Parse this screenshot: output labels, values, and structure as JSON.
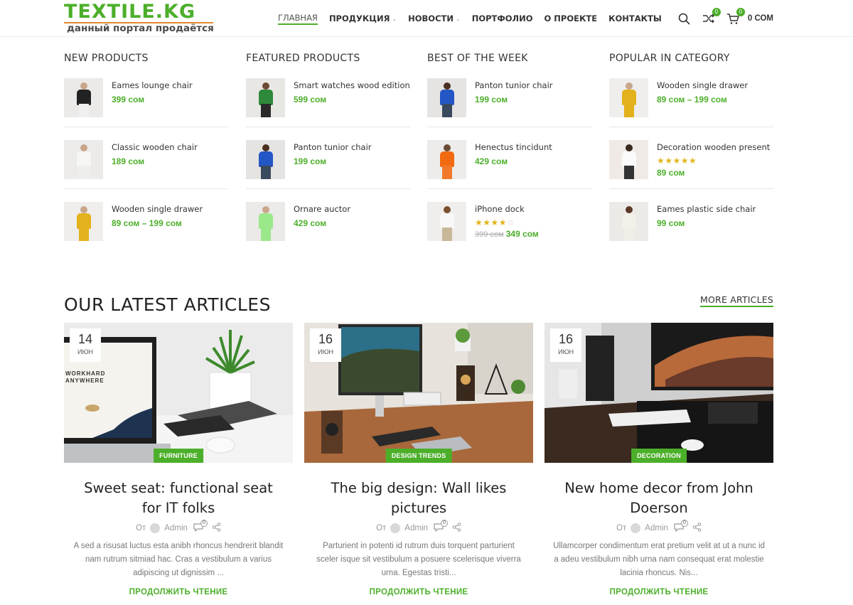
{
  "header": {
    "logo_main": "TEXTILE.KG",
    "logo_sub": "данный портал продаётся",
    "nav": [
      {
        "label": "ГЛАВНАЯ",
        "active": true,
        "dropdown": false
      },
      {
        "label": "ПРОДУКЦИЯ",
        "active": false,
        "dropdown": true
      },
      {
        "label": "НОВОСТИ",
        "active": false,
        "dropdown": true
      },
      {
        "label": "ПОРТФОЛИО",
        "active": false,
        "dropdown": false
      },
      {
        "label": "О ПРОЕКТЕ",
        "active": false,
        "dropdown": false
      },
      {
        "label": "КОНТАКТЫ",
        "active": false,
        "dropdown": false
      }
    ],
    "icons": {
      "search": "search-icon",
      "compare": "compare-icon",
      "cart": "cart-icon"
    },
    "compare_count": "0",
    "cart_count": "0",
    "cart_total": "0 СОМ"
  },
  "columns": [
    {
      "title": "NEW PRODUCTS",
      "items": [
        {
          "name": "Eames lounge chair",
          "price": "399 сом",
          "old_price": "",
          "stars": 0
        },
        {
          "name": "Classic wooden chair",
          "price": "189 сом",
          "old_price": "",
          "stars": 0
        },
        {
          "name": "Wooden single drawer",
          "price": "89 сом – 199 сом",
          "old_price": "",
          "stars": 0
        }
      ]
    },
    {
      "title": "FEATURED PRODUCTS",
      "items": [
        {
          "name": "Smart watches wood edition",
          "price": "599 сом",
          "old_price": "",
          "stars": 0
        },
        {
          "name": "Panton tunior chair",
          "price": "199 сом",
          "old_price": "",
          "stars": 0
        },
        {
          "name": "Ornare auctor",
          "price": "429 сом",
          "old_price": "",
          "stars": 0
        }
      ]
    },
    {
      "title": "BEST OF THE WEEK",
      "items": [
        {
          "name": "Panton tunior chair",
          "price": "199 сом",
          "old_price": "",
          "stars": 0
        },
        {
          "name": "Henectus tincidunt",
          "price": "429 сом",
          "old_price": "",
          "stars": 0
        },
        {
          "name": "iPhone dock",
          "price": "349 сом",
          "old_price": "399 сом",
          "stars": 4
        }
      ]
    },
    {
      "title": "POPULAR IN CATEGORY",
      "items": [
        {
          "name": "Wooden single drawer",
          "price": "89 сом – 199 сом",
          "old_price": "",
          "stars": 0
        },
        {
          "name": "Decoration wooden present",
          "price": "89 сом",
          "old_price": "",
          "stars": 5
        },
        {
          "name": "Eames plastic side chair",
          "price": "99 сом",
          "old_price": "",
          "stars": 0
        }
      ]
    }
  ],
  "articles_section": {
    "title": "OUR LATEST ARTICLES",
    "more_label": "MORE ARTICLES"
  },
  "articles": [
    {
      "day": "14",
      "month": "ИЮН",
      "category": "FURNITURE",
      "title": "Sweet seat: functional seat for IT folks",
      "by": "От",
      "author": "Admin",
      "comments": "0",
      "excerpt": "A sed a risusat luctus esta anibh rhoncus hendrerit blandit nam rutrum sitmiad hac. Cras a vestibulum a varius adipiscing ut dignissim ...",
      "read_more": "ПРОДОЛЖИТЬ ЧТЕНИЕ",
      "laptop_text": "WORKHARD ANYWHERE"
    },
    {
      "day": "16",
      "month": "ИЮН",
      "category": "DESIGN TRENDS",
      "title": "The big design: Wall likes pictures",
      "by": "От",
      "author": "Admin",
      "comments": "0",
      "excerpt": "Parturient in potenti id rutrum duis torquent parturient sceler isque sit vestibulum a posuere scelerisque viverra urna. Egestas tristi...",
      "read_more": "ПРОДОЛЖИТЬ ЧТЕНИЕ"
    },
    {
      "day": "16",
      "month": "ИЮН",
      "category": "DECORATION",
      "title": "New home decor from John Doerson",
      "by": "От",
      "author": "Admin",
      "comments": "0",
      "excerpt": "Ullamcorper condimentum erat pretium velit at ut a nunc id a adeu vestibulum nibh urna nam consequat erat molestie lacinia rhoncus. Nis...",
      "read_more": "ПРОДОЛЖИТЬ ЧТЕНИЕ"
    }
  ],
  "colors": {
    "accent": "#4caf2a",
    "logo_line": "#e08a2c",
    "text": "#333333",
    "star": "#e3b41a"
  }
}
